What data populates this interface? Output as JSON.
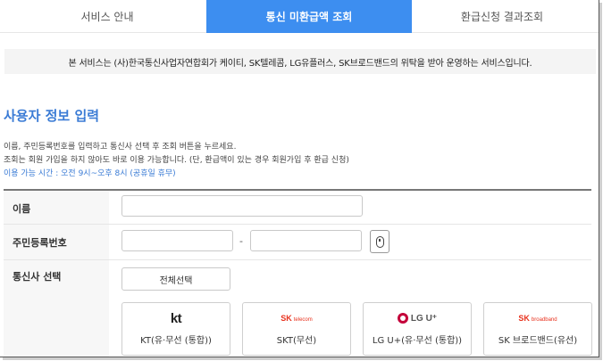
{
  "tabs": [
    {
      "label": "서비스 안내"
    },
    {
      "label": "통신 미환급액 조회"
    },
    {
      "label": "환급신청 결과조회"
    }
  ],
  "notice": "본 서비스는 (사)한국통신사업자연합회가 케이티, SK텔레콤, LG유플러스, SK브로드밴드의 위탁을 받아 운영하는 서비스입니다.",
  "section": {
    "title": "사용자 정보 입력",
    "desc1": "이름, 주민등록번호를 입력하고 통신사 선택 후 조회 버튼을 누르세요.",
    "desc2": "조회는 회원 가입을 하지 않아도 바로 이용 가능합니다. (단, 환급액이 있는 경우 회원가입 후 환급 신청)",
    "desc3": "이용 가능 시간 : 오전 9시~오후 8시 (공휴일 휴무)"
  },
  "form": {
    "name_label": "이름",
    "rrn_label": "주민등록번호",
    "rrn_dash": "-",
    "carrier_label": "통신사 선택",
    "select_all": "전체선택",
    "carriers": [
      {
        "logo": "kt",
        "name": "KT(유·무선 (통합))"
      },
      {
        "logo_main": "SK",
        "logo_sub": "telecom",
        "name": "SKT(무선)"
      },
      {
        "logo": "LG U⁺",
        "name": "LG U+(유·무선 (통합))"
      },
      {
        "logo_main": "SK",
        "logo_sub": "broadband",
        "name": "SK 브로드밴드(유선)"
      }
    ]
  },
  "colors": {
    "accent": "#3d8ef0",
    "heading": "#3a7bd5",
    "sk_red": "#e8321e",
    "lg_magenta": "#c4003a"
  }
}
